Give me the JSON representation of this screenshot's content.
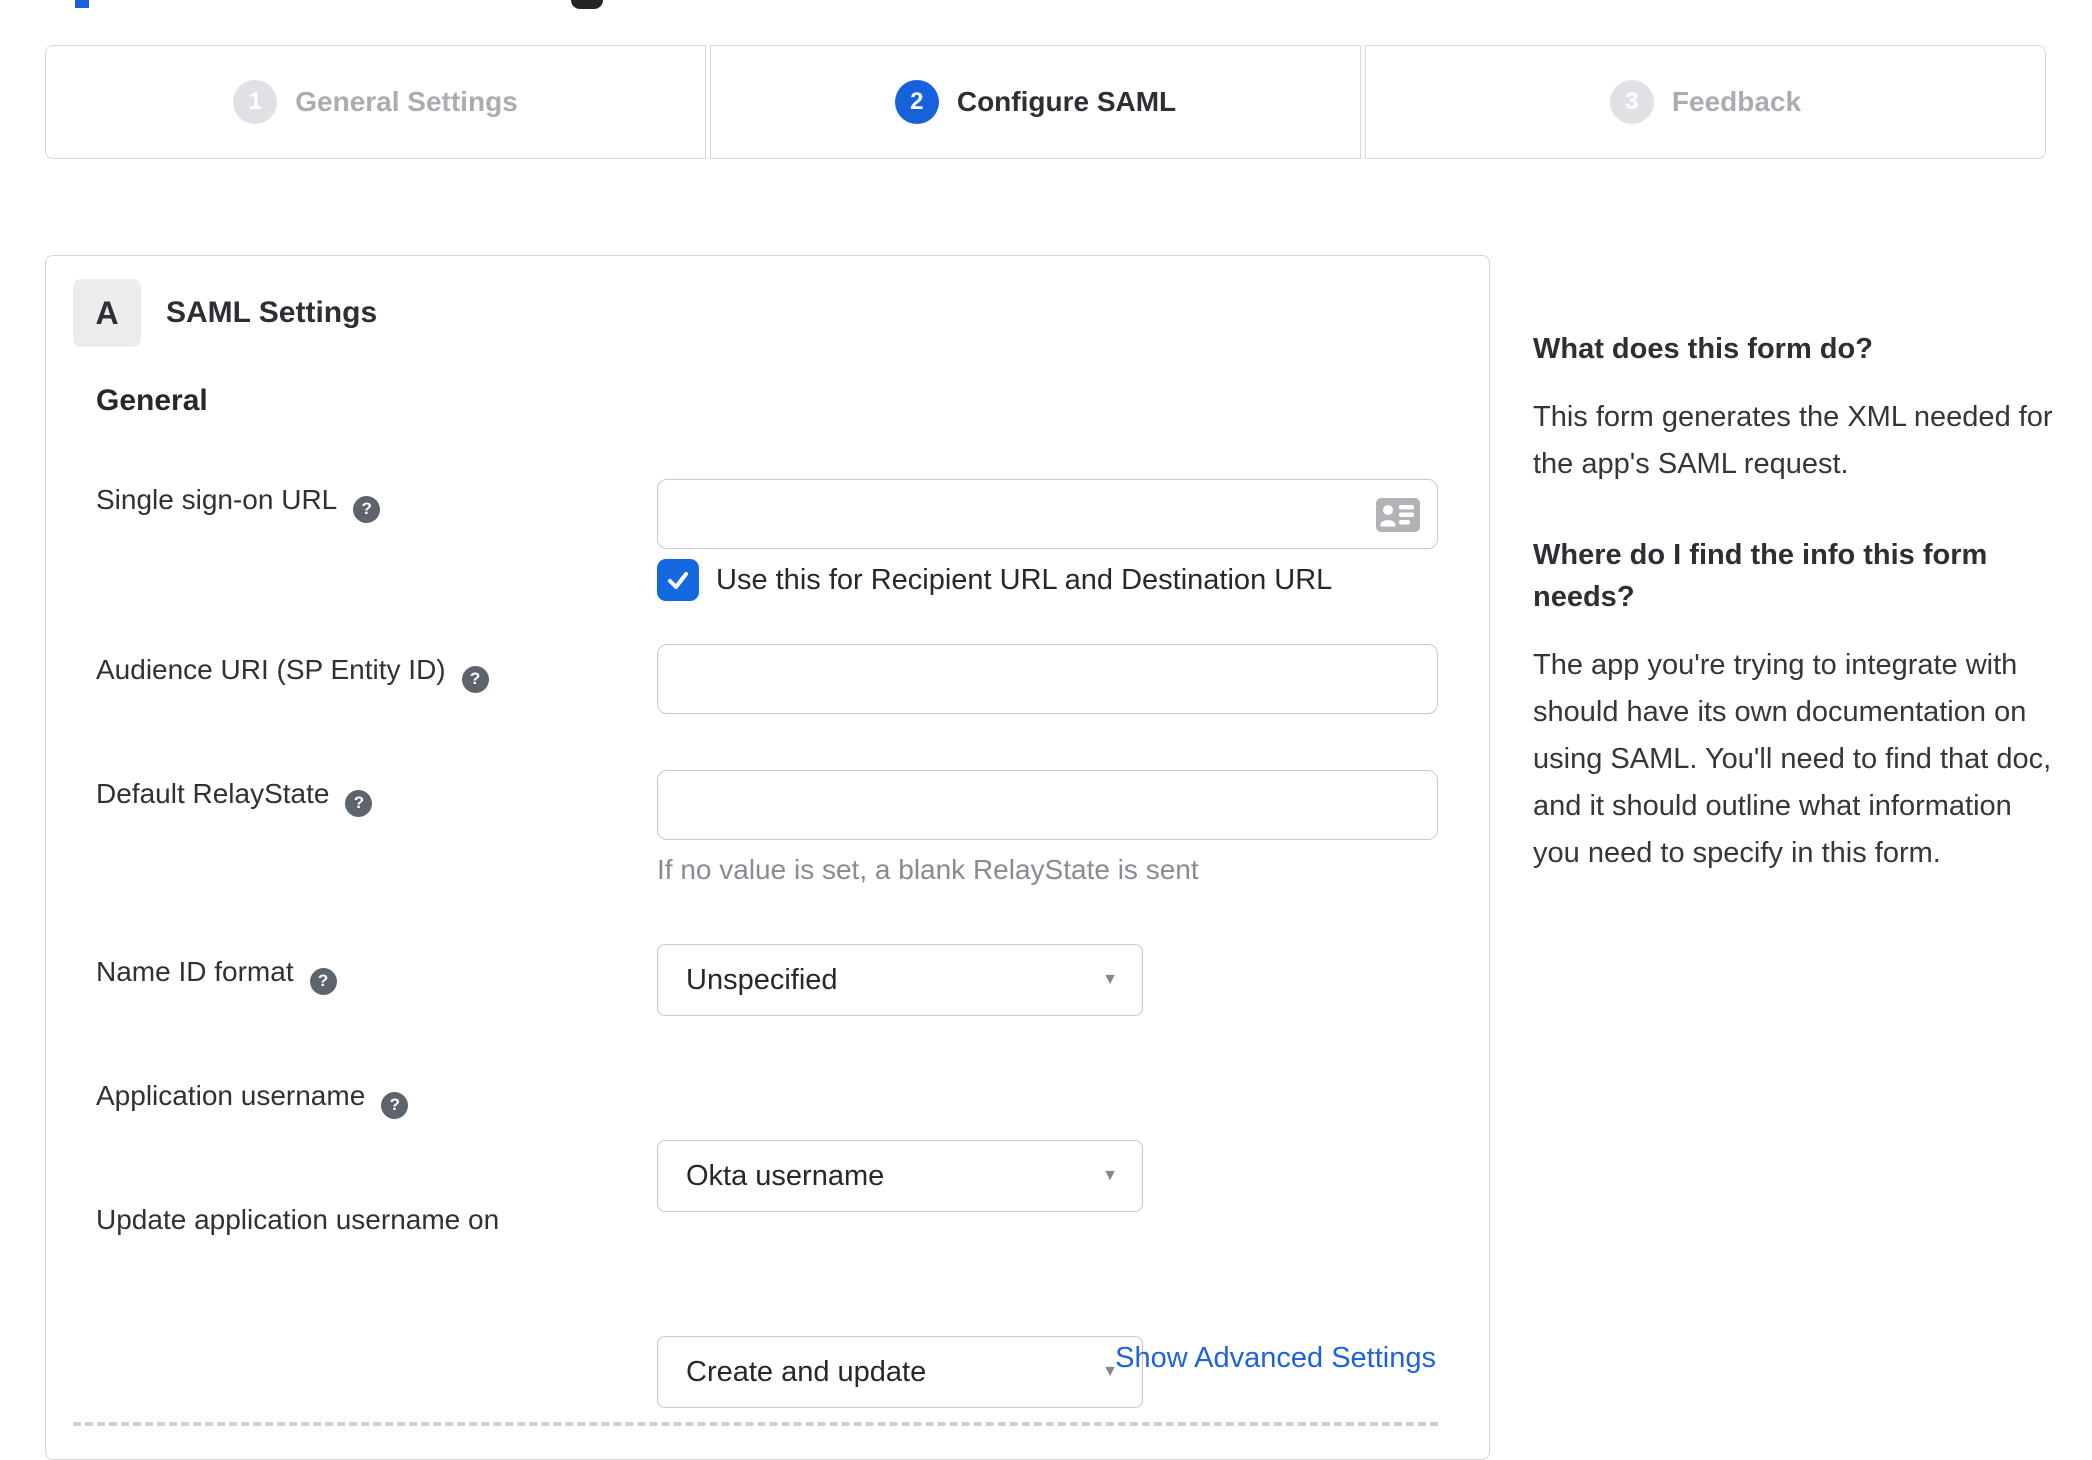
{
  "stepper": {
    "steps": [
      {
        "number": "1",
        "label": "General Settings",
        "state": "inactive"
      },
      {
        "number": "2",
        "label": "Configure SAML",
        "state": "active"
      },
      {
        "number": "3",
        "label": "Feedback",
        "state": "inactive"
      }
    ],
    "active_color": "#1662dd"
  },
  "form_card": {
    "section_badge": "A",
    "section_title": "SAML Settings",
    "group_heading": "General",
    "fields": {
      "sso_url": {
        "label": "Single sign-on URL",
        "value": "",
        "checkbox_label": "Use this for Recipient URL and Destination URL",
        "checkbox_checked": true
      },
      "audience_uri": {
        "label": "Audience URI (SP Entity ID)",
        "value": ""
      },
      "default_relaystate": {
        "label": "Default RelayState",
        "value": "",
        "hint": "If no value is set, a blank RelayState is sent"
      },
      "name_id_format": {
        "label": "Name ID format",
        "value": "Unspecified"
      },
      "app_username": {
        "label": "Application username",
        "value": "Okta username"
      },
      "update_app_username": {
        "label": "Update application username on",
        "value": "Create and update"
      }
    },
    "advanced_link": "Show Advanced Settings",
    "help_icon_glyph": "?"
  },
  "help_panel": {
    "section1": {
      "heading": "What does this form do?",
      "body": "This form generates the XML needed for the app's SAML request."
    },
    "section2": {
      "heading": "Where do I find the info this form needs?",
      "body": "The app you're trying to integrate with should have its own documentation on using SAML. You'll need to find that doc, and it should outline what information you need to specify in this form."
    }
  },
  "colors": {
    "accent_blue": "#1662dd",
    "checkbox_blue": "#1469e0",
    "link_blue": "#1f62da",
    "border_gray": "#d8d8dc",
    "inactive_gray": "#a9acb1",
    "hint_gray": "#888c92"
  }
}
